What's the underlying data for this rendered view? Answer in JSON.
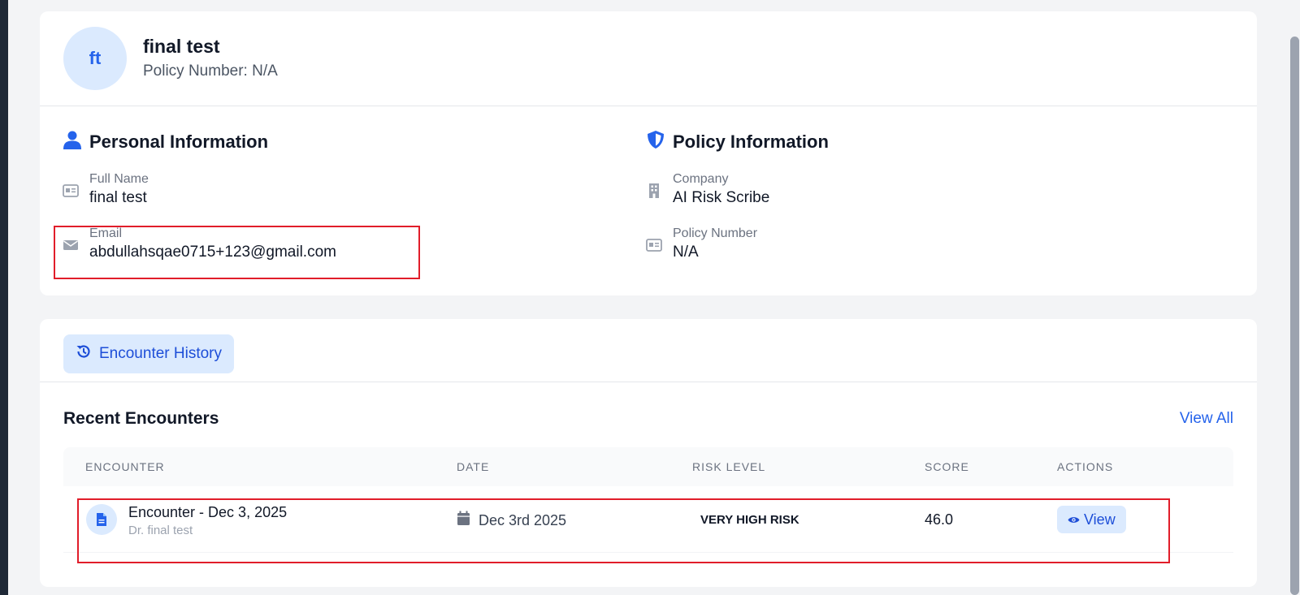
{
  "profile": {
    "initials": "ft",
    "name": "final test",
    "policy_line": "Policy Number: N/A"
  },
  "personal": {
    "title": "Personal Information",
    "full_name_label": "Full Name",
    "full_name_value": "final test",
    "email_label": "Email",
    "email_value": "abdullahsqae0715+123@gmail.com"
  },
  "policy": {
    "title": "Policy Information",
    "company_label": "Company",
    "company_value": "AI Risk Scribe",
    "policy_number_label": "Policy Number",
    "policy_number_value": "N/A"
  },
  "encounters": {
    "tab_label": "Encounter History",
    "recent_title": "Recent Encounters",
    "view_all": "View All",
    "columns": [
      "ENCOUNTER",
      "DATE",
      "RISK LEVEL",
      "SCORE",
      "ACTIONS"
    ],
    "rows": [
      {
        "title": "Encounter - Dec 3, 2025",
        "doctor": "Dr. final test",
        "date": "Dec 3rd 2025",
        "risk": "VERY HIGH RISK",
        "score": "46.0",
        "action": "View"
      }
    ]
  },
  "colors": {
    "accent": "#2563eb",
    "accent_soft": "#dbeafe",
    "highlight": "#e11d2a"
  },
  "icons": [
    "user-icon",
    "shield-icon",
    "id-card-icon",
    "envelope-icon",
    "building-icon",
    "history-icon",
    "document-icon",
    "calendar-icon",
    "eye-icon"
  ]
}
